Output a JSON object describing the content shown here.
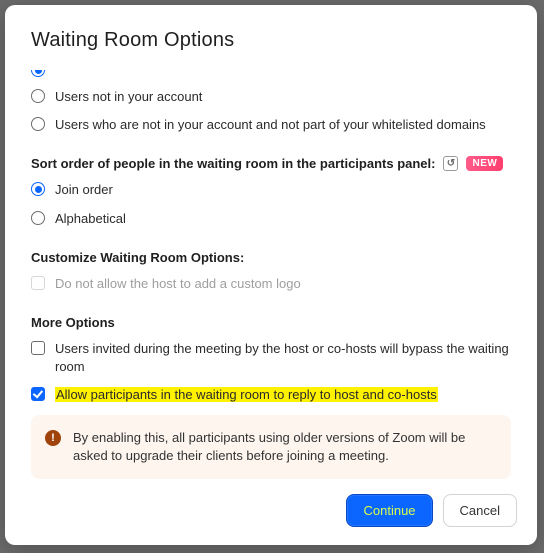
{
  "title": "Waiting Room Options",
  "who_bypasses": {
    "options": [
      {
        "id": "not-in-account",
        "label": "Users not in your account",
        "selected": false
      },
      {
        "id": "not-in-account-or-domain",
        "label": "Users who are not in your account and not part of your whitelisted domains",
        "selected": false
      }
    ]
  },
  "sort_order": {
    "header": "Sort order of people in the waiting room in the participants panel:",
    "new_badge": "NEW",
    "options": [
      {
        "id": "join-order",
        "label": "Join order",
        "selected": true
      },
      {
        "id": "alphabetical",
        "label": "Alphabetical",
        "selected": false
      }
    ]
  },
  "customize": {
    "header": "Customize Waiting Room Options:",
    "logo_option": "Do not allow the host to add a custom logo"
  },
  "more": {
    "header": "More Options",
    "bypass_option": "Users invited during the meeting by the host or co-hosts will bypass the waiting room",
    "reply_option": "Allow participants in the waiting room to reply to host and co-hosts"
  },
  "warning": {
    "text": "By enabling this, all participants using older versions of Zoom will be asked to upgrade their clients before joining a meeting."
  },
  "footer": {
    "continue": "Continue",
    "cancel": "Cancel"
  }
}
